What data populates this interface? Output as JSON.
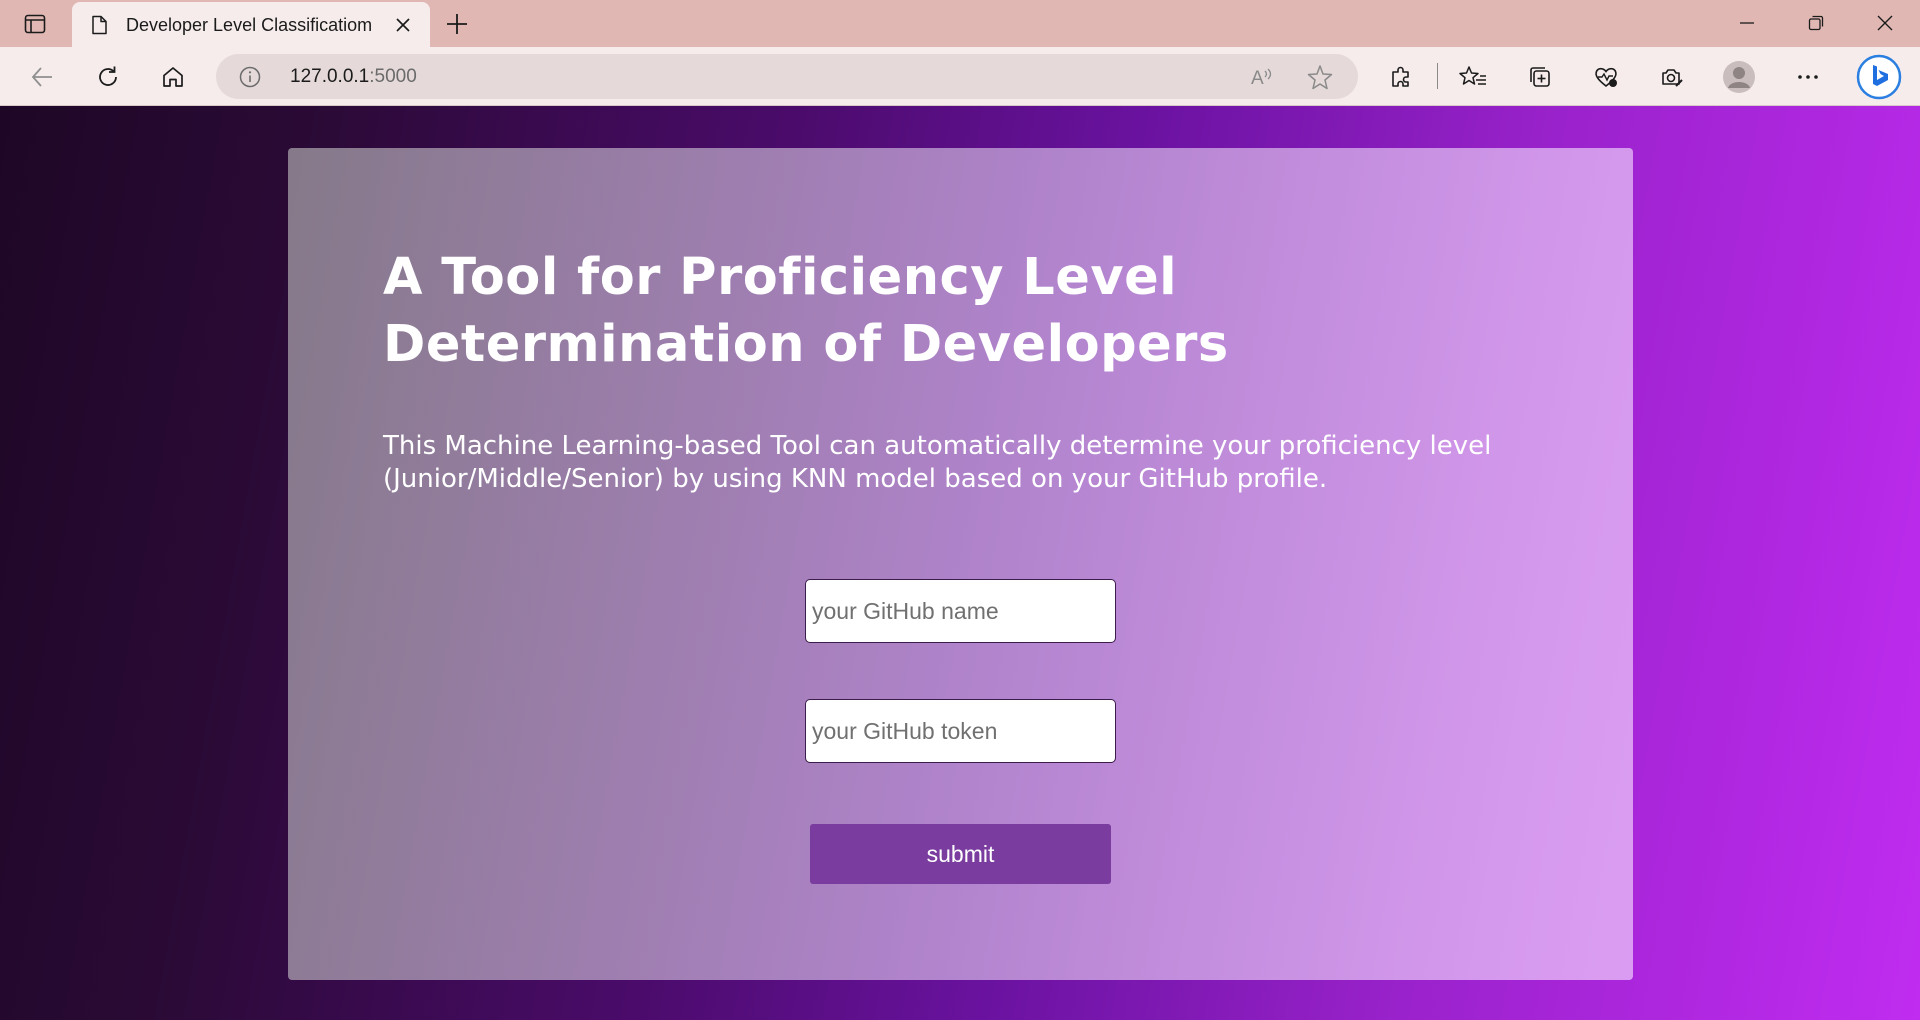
{
  "browser": {
    "tab": {
      "title": "Developer Level Classificatiom"
    },
    "address": {
      "host": "127.0.0.1",
      "port": ":5000"
    }
  },
  "page": {
    "title_line1": "A Tool for Proficiency Level",
    "title_line2": "Determination of Developers",
    "description_line1": "This Machine Learning-based Tool can automatically determine your proficiency level",
    "description_line2": "(Junior/Middle/Senior) by using KNN model based on your GitHub profile.",
    "form": {
      "name_placeholder": "your GitHub name",
      "token_placeholder": "your GitHub token",
      "submit_label": "submit"
    }
  },
  "colors": {
    "submit": "#7a3c9e",
    "tabbar": "#e0b7b3",
    "toolbar": "#f6ecec"
  }
}
